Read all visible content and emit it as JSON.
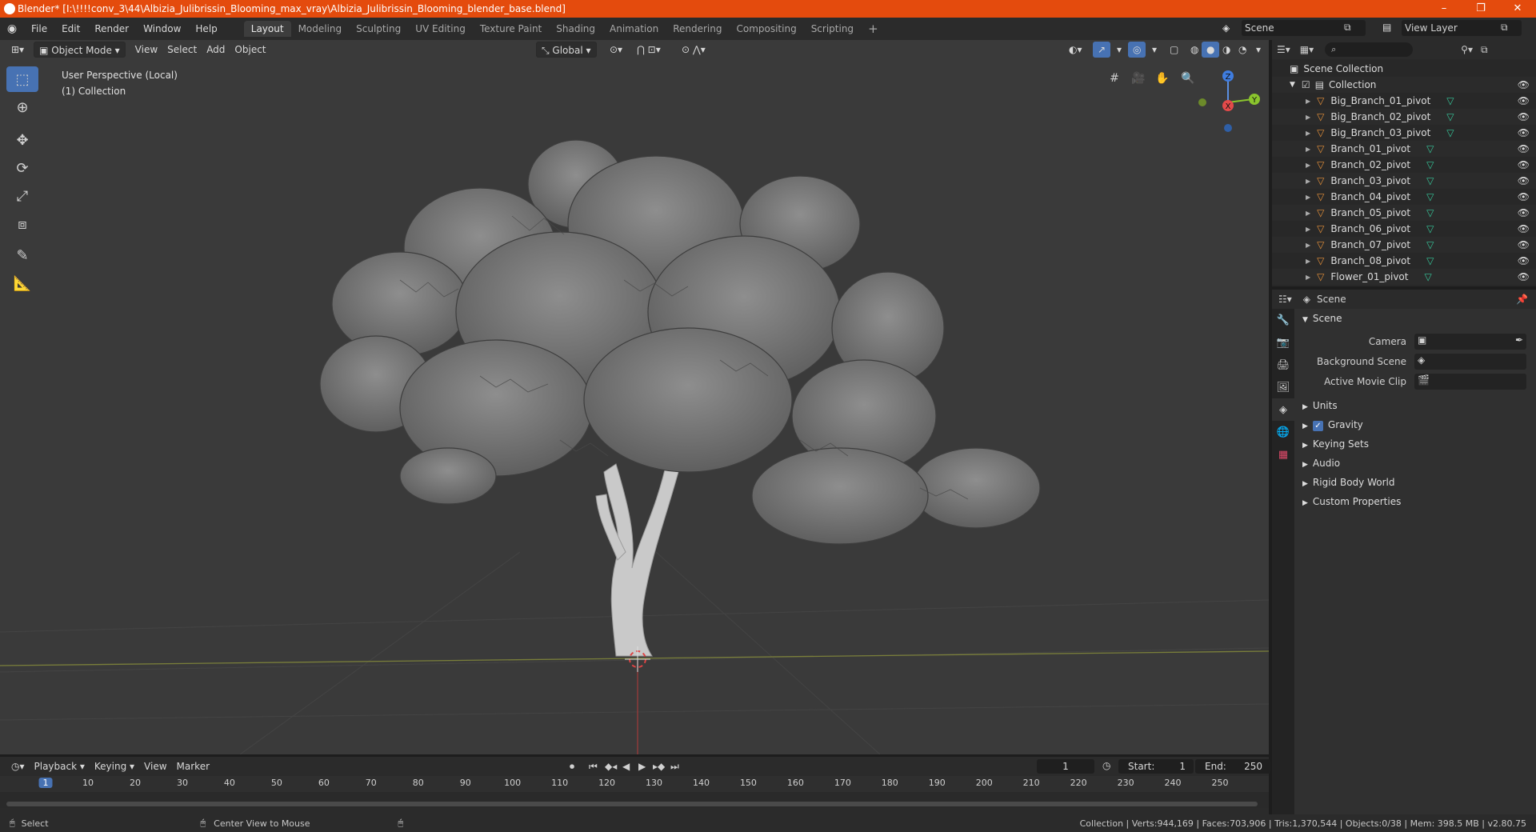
{
  "window": {
    "title": "Blender* [I:\\!!!!conv_3\\44\\Albizia_Julibrissin_Blooming_max_vray\\Albizia_Julibrissin_Blooming_blender_base.blend]",
    "minimize": "–",
    "maximize": "❐",
    "close": "✕"
  },
  "menubar": [
    "File",
    "Edit",
    "Render",
    "Window",
    "Help"
  ],
  "workspaces": [
    "Layout",
    "Modeling",
    "Sculpting",
    "UV Editing",
    "Texture Paint",
    "Shading",
    "Animation",
    "Rendering",
    "Compositing",
    "Scripting"
  ],
  "active_workspace": "Layout",
  "add_workspace": "+",
  "scene_name": "Scene",
  "view_layer": "View Layer",
  "viewport": {
    "mode": "Object Mode",
    "menus": [
      "View",
      "Select",
      "Add",
      "Object"
    ],
    "orientation": "Global",
    "perspective": "User Perspective (Local)",
    "collection": "(1) Collection",
    "gizmo": {
      "z": "Z",
      "y": "Y",
      "x": "X"
    }
  },
  "outliner": {
    "root": "Scene Collection",
    "collection": "Collection",
    "items": [
      "Big_Branch_01_pivot",
      "Big_Branch_02_pivot",
      "Big_Branch_03_pivot",
      "Branch_01_pivot",
      "Branch_02_pivot",
      "Branch_03_pivot",
      "Branch_04_pivot",
      "Branch_05_pivot",
      "Branch_06_pivot",
      "Branch_07_pivot",
      "Branch_08_pivot",
      "Flower_01_pivot"
    ]
  },
  "properties": {
    "context": "Scene",
    "panel": "Scene",
    "fields": {
      "camera": "Camera",
      "background_scene": "Background Scene",
      "active_movie_clip": "Active Movie Clip"
    },
    "subpanels": [
      "Units",
      "Gravity",
      "Keying Sets",
      "Audio",
      "Rigid Body World",
      "Custom Properties"
    ],
    "gravity_checked": true
  },
  "timeline": {
    "menus": [
      "Playback",
      "Keying",
      "View",
      "Marker"
    ],
    "current_frame": "1",
    "start_label": "Start:",
    "start": "1",
    "end_label": "End:",
    "end": "250",
    "ruler": [
      "1",
      "10",
      "20",
      "30",
      "40",
      "50",
      "60",
      "70",
      "80",
      "90",
      "100",
      "110",
      "120",
      "130",
      "140",
      "150",
      "160",
      "170",
      "180",
      "190",
      "200",
      "210",
      "220",
      "230",
      "240",
      "250"
    ]
  },
  "status": {
    "left1": "Select",
    "left2": "Center View to Mouse",
    "right": "Collection | Verts:944,169 | Faces:703,906 | Tris:1,370,544 | Objects:0/38 | Mem: 398.5 MB | v2.80.75"
  }
}
